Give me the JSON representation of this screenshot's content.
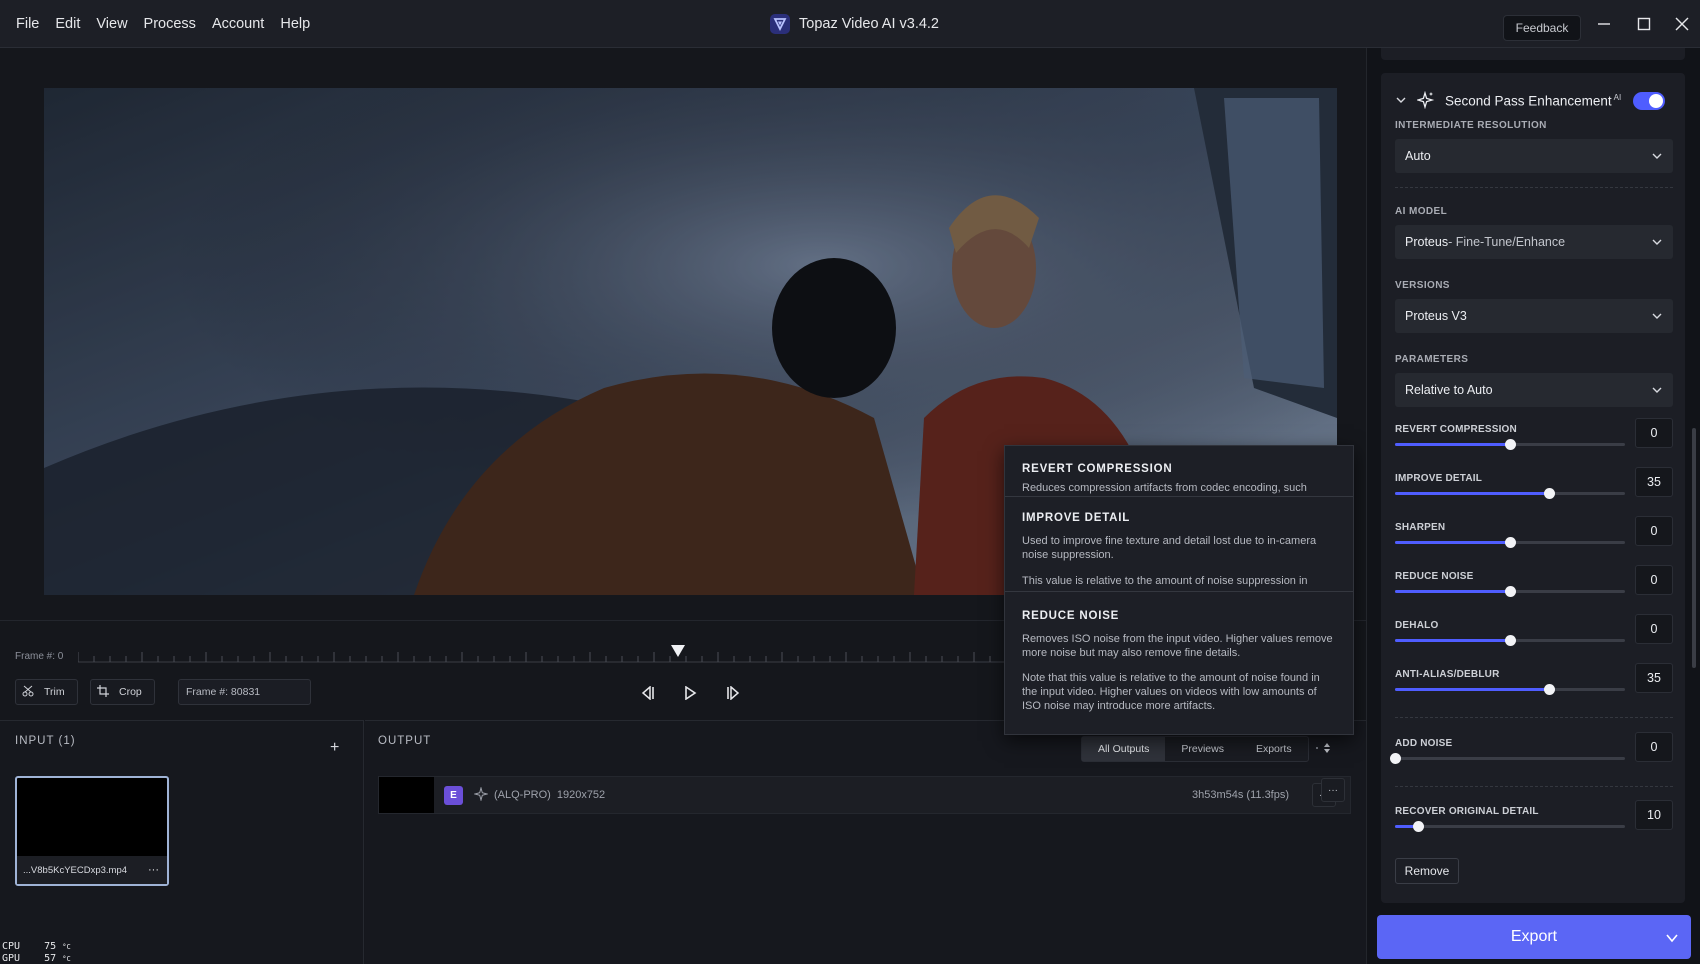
{
  "menu": [
    "File",
    "Edit",
    "View",
    "Process",
    "Account",
    "Help"
  ],
  "app_title": "Topaz Video AI  v3.4.2",
  "feedback_label": "Feedback",
  "timeline": {
    "frame_start": "Frame #: 0",
    "trim_label": "Trim",
    "crop_label": "Crop",
    "frame_field": "Frame #: 80831"
  },
  "input_panel": {
    "title": "INPUT (1)",
    "add": "+",
    "file_name": "...V8b5KcYECDxp3.mp4",
    "more": "···"
  },
  "sys_stats": {
    "cpu_label": "CPU",
    "cpu_value": "75",
    "gpu_label": "GPU",
    "gpu_value": "57",
    "unit": "°C"
  },
  "output_panel": {
    "title": "OUTPUT",
    "tabs": [
      "All Outputs",
      "Previews",
      "Exports"
    ],
    "row": {
      "badge": "E",
      "model": "(ALQ-PRO)",
      "resolution": "1920x752",
      "time": "3h53m54s (11.3fps)",
      "more": "···"
    }
  },
  "tooltip": {
    "sections": [
      {
        "title": "REVERT COMPRESSION",
        "text": "Reduces compression artifacts from codec encoding, such"
      },
      {
        "title": "IMPROVE DETAIL",
        "text": "Used to improve fine texture and detail lost due to in-camera noise suppression.",
        "text2": "This value is relative to the amount of noise suppression in"
      },
      {
        "title": "REDUCE NOISE",
        "text": "Removes ISO noise from the input video. Higher values remove more noise but may also remove fine details.",
        "text2": "Note that this value is relative to the amount of noise found in the input video. Higher values on videos with low amounts of ISO noise may introduce more artifacts."
      }
    ]
  },
  "right_panel": {
    "section_title": "Second Pass Enhancement",
    "ai_tag": "AI",
    "toggle_on": true,
    "intermediate_resolution": {
      "label": "INTERMEDIATE RESOLUTION",
      "value": "Auto"
    },
    "ai_model": {
      "label": "AI MODEL",
      "value": "Proteus",
      "suffix": " - Fine-Tune/Enhance"
    },
    "versions": {
      "label": "VERSIONS",
      "value": "Proteus V3"
    },
    "parameters": {
      "label": "PARAMETERS",
      "value": "Relative to Auto"
    },
    "sliders": [
      {
        "label": "REVERT COMPRESSION",
        "value": "0",
        "position": 0.5
      },
      {
        "label": "IMPROVE DETAIL",
        "value": "35",
        "position": 0.67
      },
      {
        "label": "SHARPEN",
        "value": "0",
        "position": 0.5
      },
      {
        "label": "REDUCE NOISE",
        "value": "0",
        "position": 0.5
      },
      {
        "label": "DEHALO",
        "value": "0",
        "position": 0.5
      },
      {
        "label": "ANTI-ALIAS/DEBLUR",
        "value": "35",
        "position": 0.67
      },
      {
        "label": "ADD NOISE",
        "value": "0",
        "position": 0.0
      },
      {
        "label": "RECOVER ORIGINAL DETAIL",
        "value": "10",
        "position": 0.1
      }
    ],
    "remove_label": "Remove",
    "export_label": "Export"
  },
  "colors": {
    "accent": "#5b66f5",
    "toggle": "#4f5dff",
    "badge": "#6b4fd8"
  }
}
